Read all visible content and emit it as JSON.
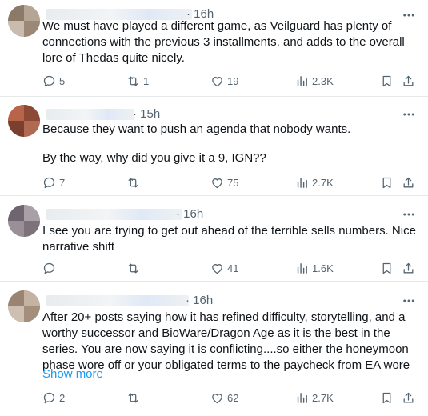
{
  "posts": [
    {
      "time": "· 16h",
      "text": [
        "We must have played a different game, as Veilguard has plenty of connections with the previous 3 installments, and adds to the overall lore of Thedas quite nicely."
      ],
      "show_more": "",
      "stats": {
        "replies": "5",
        "reposts": "1",
        "likes": "19",
        "views": "2.3K"
      }
    },
    {
      "time": "· 15h",
      "text": [
        "Because they want to push an agenda that nobody wants.",
        "By the way, why did you give it a 9, IGN??"
      ],
      "show_more": "",
      "stats": {
        "replies": "7",
        "reposts": "",
        "likes": "75",
        "views": "2.7K"
      }
    },
    {
      "time": "· 16h",
      "text": [
        "I see you are trying to get out ahead of the terrible sells numbers. Nice narrative shift"
      ],
      "show_more": "",
      "stats": {
        "replies": "",
        "reposts": "",
        "likes": "41",
        "views": "1.6K"
      }
    },
    {
      "time": "· 16h",
      "text": [
        "After 20+ posts saying how it has refined difficulty, storytelling, and a worthy successor and BioWare/Dragon Age as it is the best in the series. You are now saying it is conflicting....so either the honeymoon phase wore off or your obligated terms to the paycheck from EA wore"
      ],
      "show_more": "Show more",
      "stats": {
        "replies": "2",
        "reposts": "",
        "likes": "62",
        "views": "2.7K"
      }
    }
  ]
}
